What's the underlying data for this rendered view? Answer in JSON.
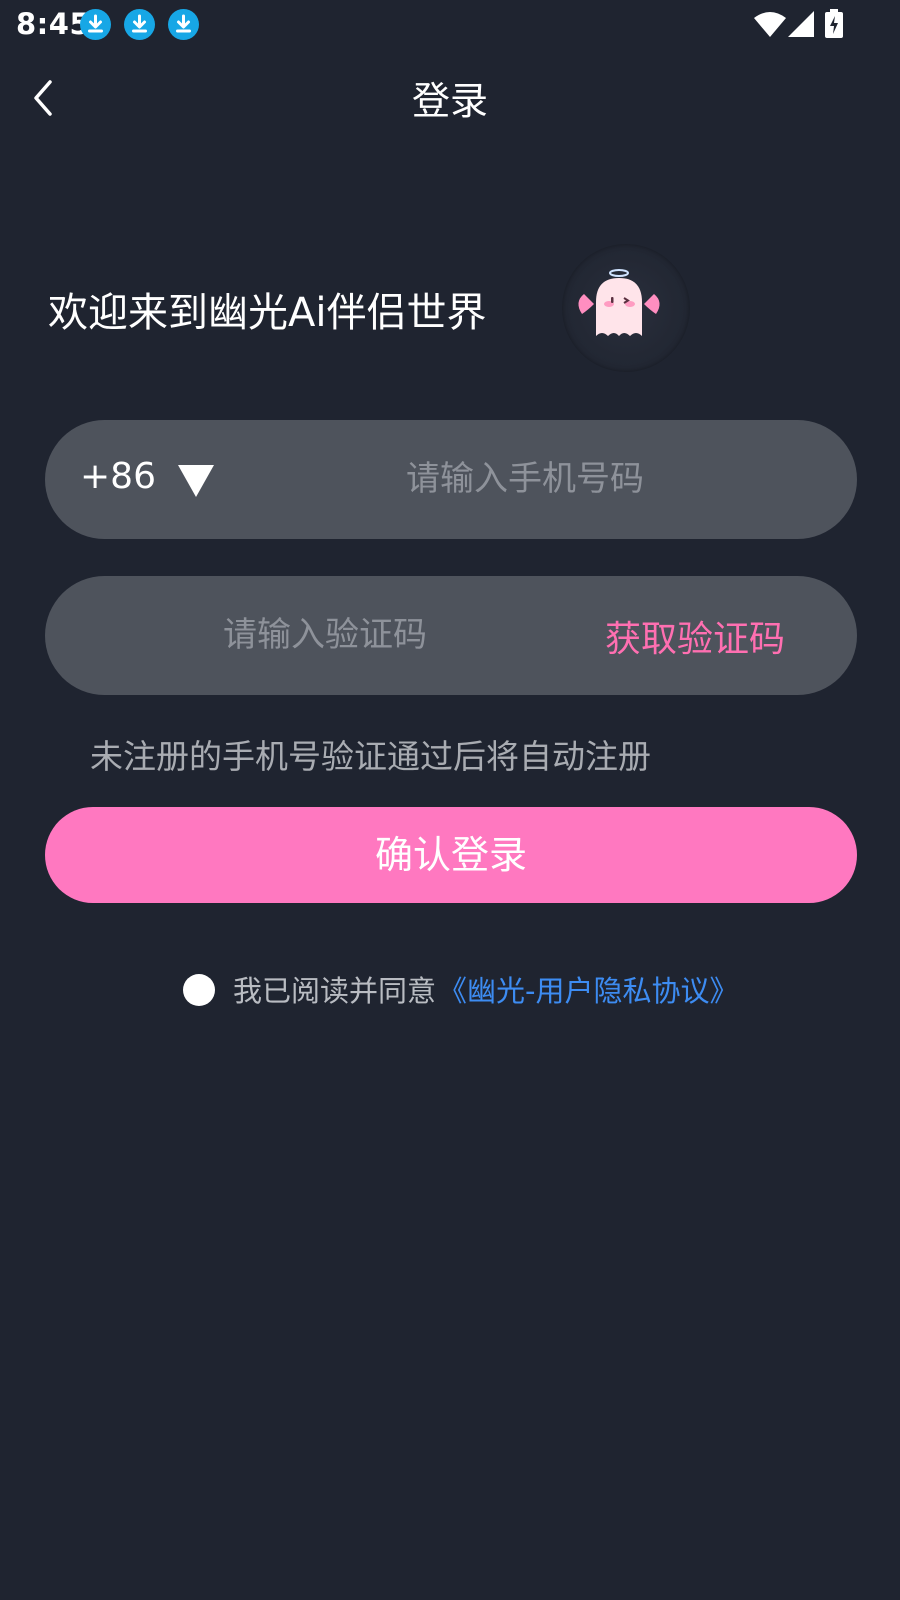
{
  "status_bar": {
    "time": "8:45",
    "icons": [
      "download-icon",
      "download-icon",
      "download-icon",
      "wifi-icon",
      "signal-icon",
      "battery-charging-icon"
    ],
    "download_icon_color": "#17a7e6"
  },
  "header": {
    "title": "登录",
    "back_icon": "chevron-left-icon"
  },
  "welcome": {
    "text": "欢迎来到幽光Ai伴侣世界",
    "mascot_icon": "ghost-angel-mascot-icon"
  },
  "phone_field": {
    "country_code": "+86",
    "dropdown_icon": "triangle-down-icon",
    "value": "",
    "placeholder": "请输入手机号码"
  },
  "code_field": {
    "value": "",
    "placeholder": "请输入验证码",
    "get_code_label": "获取验证码"
  },
  "hint": "未注册的手机号验证通过后将自动注册",
  "confirm_button": {
    "label": "确认登录"
  },
  "agreement": {
    "checked": false,
    "text": "我已阅读并同意",
    "link_text": "《幽光-用户隐私协议》"
  },
  "colors": {
    "background": "#1f2430",
    "field_background": "#4e535c",
    "accent_pink": "#ff78c0",
    "link_blue": "#3d8cf2",
    "get_code_pink": "#ff6fb1"
  }
}
